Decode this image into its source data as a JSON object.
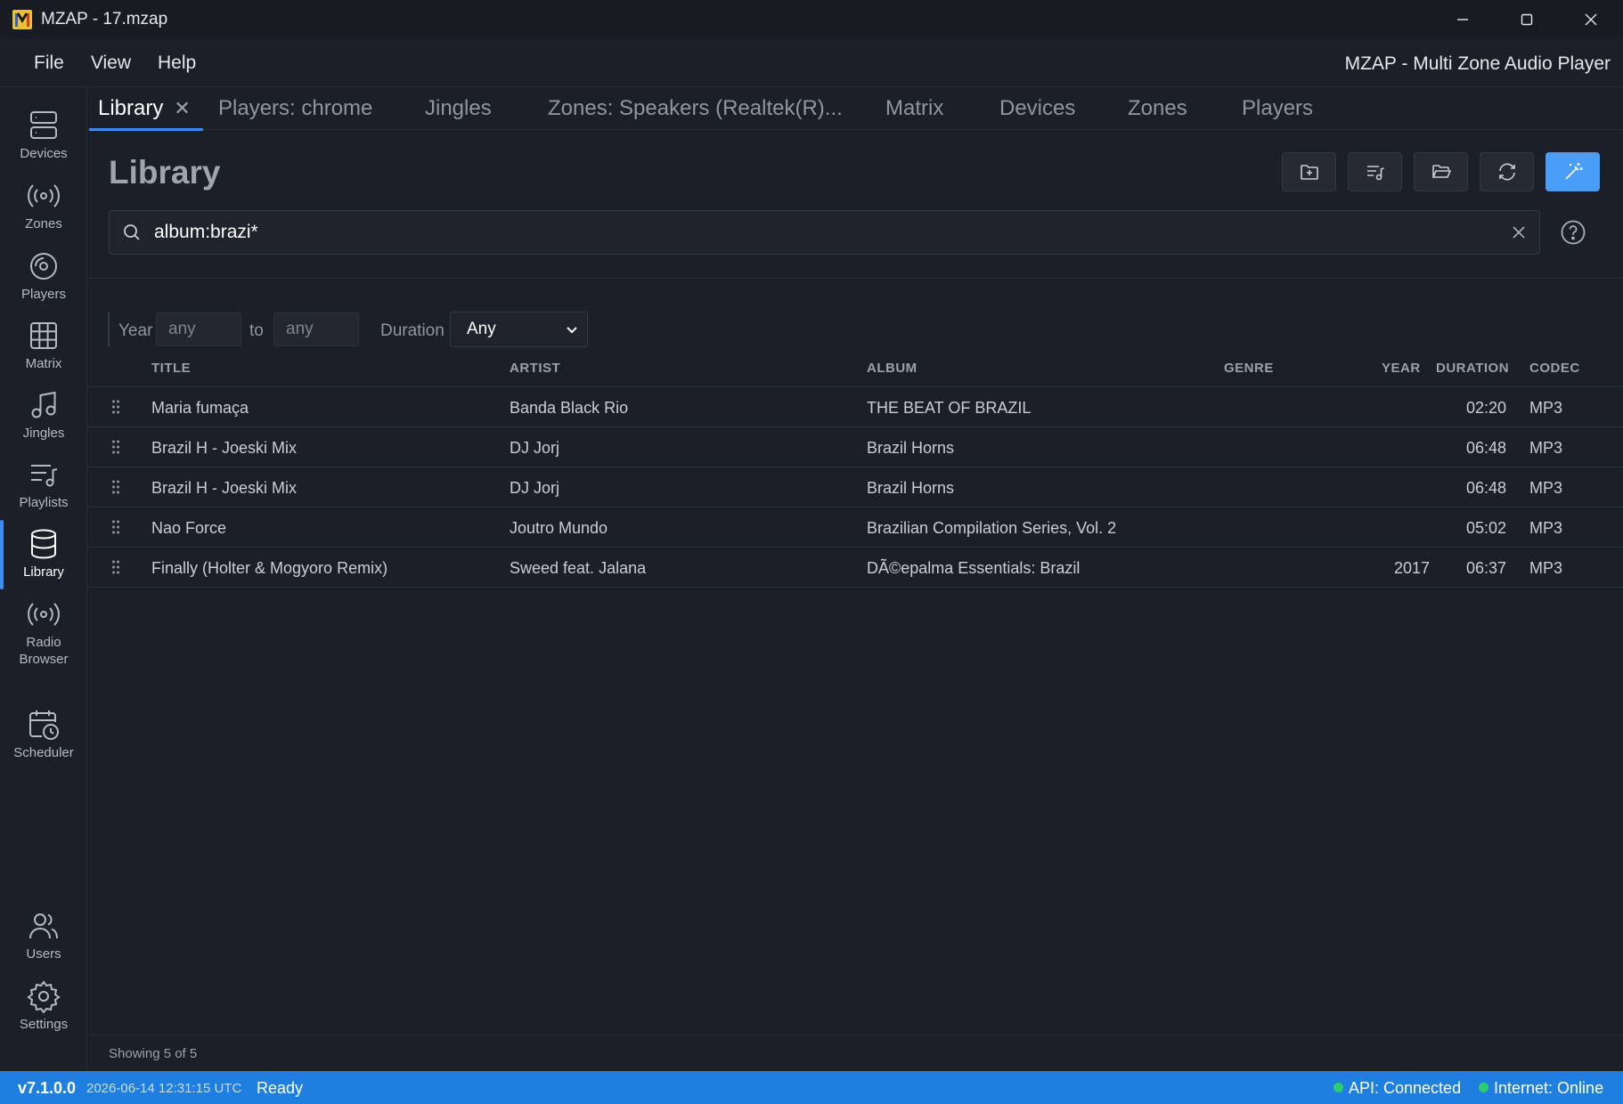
{
  "window": {
    "title": "MZAP - 17.mzap"
  },
  "menu": {
    "items": [
      "File",
      "View",
      "Help"
    ],
    "app_name": "MZAP - Multi Zone Audio Player"
  },
  "sidebar": {
    "items": [
      {
        "label": "Devices",
        "icon": "devices-icon"
      },
      {
        "label": "Zones",
        "icon": "broadcast-icon"
      },
      {
        "label": "Players",
        "icon": "disc-icon"
      },
      {
        "label": "Matrix",
        "icon": "grid-icon"
      },
      {
        "label": "Jingles",
        "icon": "music-note-icon"
      },
      {
        "label": "Playlists",
        "icon": "playlist-icon"
      },
      {
        "label": "Library",
        "icon": "database-icon"
      },
      {
        "label": "Radio Browser",
        "icon": "broadcast-icon"
      },
      {
        "label": "Scheduler",
        "icon": "calendar-clock-icon"
      },
      {
        "label": "Users",
        "icon": "users-icon"
      },
      {
        "label": "Settings",
        "icon": "gear-icon"
      }
    ]
  },
  "tabs": [
    "Library",
    "Players: chrome",
    "Jingles",
    "Zones: Speakers (Realtek(R)...",
    "Matrix",
    "Devices",
    "Zones",
    "Players"
  ],
  "page": {
    "title": "Library"
  },
  "search": {
    "value": "album:brazi*"
  },
  "filters": {
    "year_label": "Year",
    "year_from": "any",
    "to_label": "to",
    "year_to": "any",
    "duration_label": "Duration",
    "duration_value": "Any"
  },
  "table": {
    "columns": [
      "TITLE",
      "ARTIST",
      "ALBUM",
      "GENRE",
      "YEAR",
      "DURATION",
      "CODEC"
    ],
    "rows": [
      {
        "title": "Maria fumaça",
        "artist": "Banda Black Rio",
        "album": "THE BEAT OF BRAZIL",
        "genre": "",
        "year": "",
        "duration": "02:20",
        "codec": "MP3"
      },
      {
        "title": "Brazil H - Joeski Mix",
        "artist": "DJ Jorj",
        "album": "Brazil Horns",
        "genre": "",
        "year": "",
        "duration": "06:48",
        "codec": "MP3"
      },
      {
        "title": "Brazil H - Joeski Mix",
        "artist": "DJ Jorj",
        "album": "Brazil Horns",
        "genre": "",
        "year": "",
        "duration": "06:48",
        "codec": "MP3"
      },
      {
        "title": "Nao Force",
        "artist": "Joutro Mundo",
        "album": "Brazilian Compilation Series, Vol. 2",
        "genre": "",
        "year": "",
        "duration": "05:02",
        "codec": "MP3"
      },
      {
        "title": "Finally (Holter & Mogyoro Remix)",
        "artist": "Sweed feat. Jalana",
        "album": "DÃ©epalma Essentials: Brazil",
        "genre": "",
        "year": "2017",
        "duration": "06:37",
        "codec": "MP3"
      }
    ]
  },
  "footer": {
    "showing": "Showing 5 of 5"
  },
  "status": {
    "version": "v7.1.0.0",
    "timestamp": "2026-06-14 12:31:15 UTC",
    "state": "Ready",
    "api": "API: Connected",
    "internet": "Internet: Online"
  },
  "colors": {
    "accent": "#3d8cf0",
    "status_bar": "#1e7fe0",
    "online": "#2ecc71",
    "primary_button": "#4a9ef8"
  }
}
